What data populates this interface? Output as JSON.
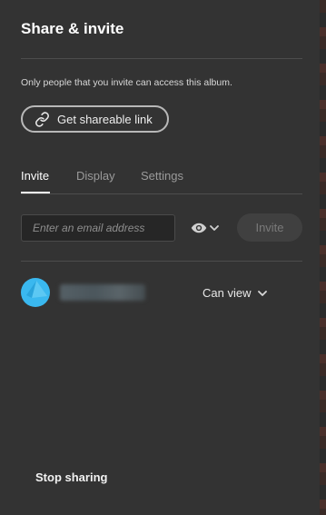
{
  "dialog": {
    "title": "Share & invite",
    "description": "Only people that you invite can access this album.",
    "shareable_link_label": "Get shareable link"
  },
  "tabs": [
    {
      "label": "Invite",
      "active": true
    },
    {
      "label": "Display",
      "active": false
    },
    {
      "label": "Settings",
      "active": false
    }
  ],
  "invite": {
    "email_placeholder": "Enter an email address",
    "email_value": "",
    "permission_icon": "eye-icon",
    "button_label": "Invite",
    "button_enabled": false
  },
  "members": [
    {
      "name_visible": false,
      "role": "Can view",
      "avatar_color": "#3ab8ef"
    }
  ],
  "footer": {
    "stop_label": "Stop sharing"
  },
  "colors": {
    "panel_bg": "#333333",
    "accent_avatar": "#3ab8ef",
    "text": "#ffffff"
  }
}
